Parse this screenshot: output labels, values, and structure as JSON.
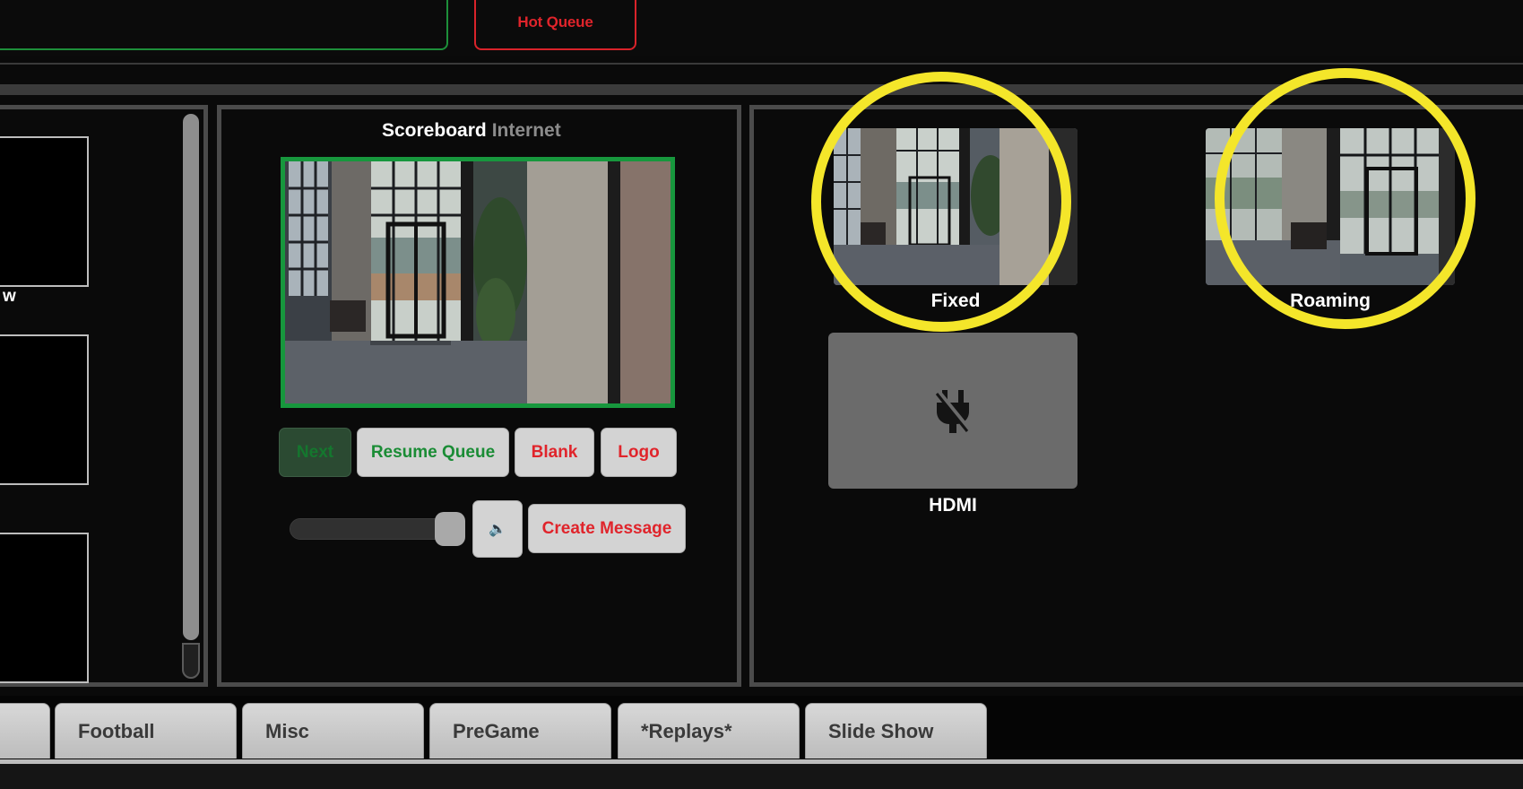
{
  "header": {
    "hot_queue_label": "Hot Queue"
  },
  "left_panel": {
    "partial_label": "w"
  },
  "scoreboard": {
    "title": "Scoreboard",
    "subtitle": "Internet",
    "buttons": {
      "next": "Next",
      "resume_queue": "Resume Queue",
      "blank": "Blank",
      "logo": "Logo",
      "create_message": "Create Message"
    },
    "volume_level": 1.0,
    "volume_icon": "speaker-icon"
  },
  "sources": [
    {
      "label": "Fixed"
    },
    {
      "label": "Roaming"
    },
    {
      "label": "HDMI",
      "icon": "unplugged-icon"
    }
  ],
  "tabs": [
    {
      "label": ""
    },
    {
      "label": "Football"
    },
    {
      "label": "Misc"
    },
    {
      "label": "PreGame"
    },
    {
      "label": "*Replays*"
    },
    {
      "label": "Slide Show"
    }
  ],
  "colors": {
    "accent_green": "#17973d",
    "accent_red": "#e0242b",
    "highlight_yellow": "#f4e62a",
    "panel_border": "#4b4b4b"
  }
}
